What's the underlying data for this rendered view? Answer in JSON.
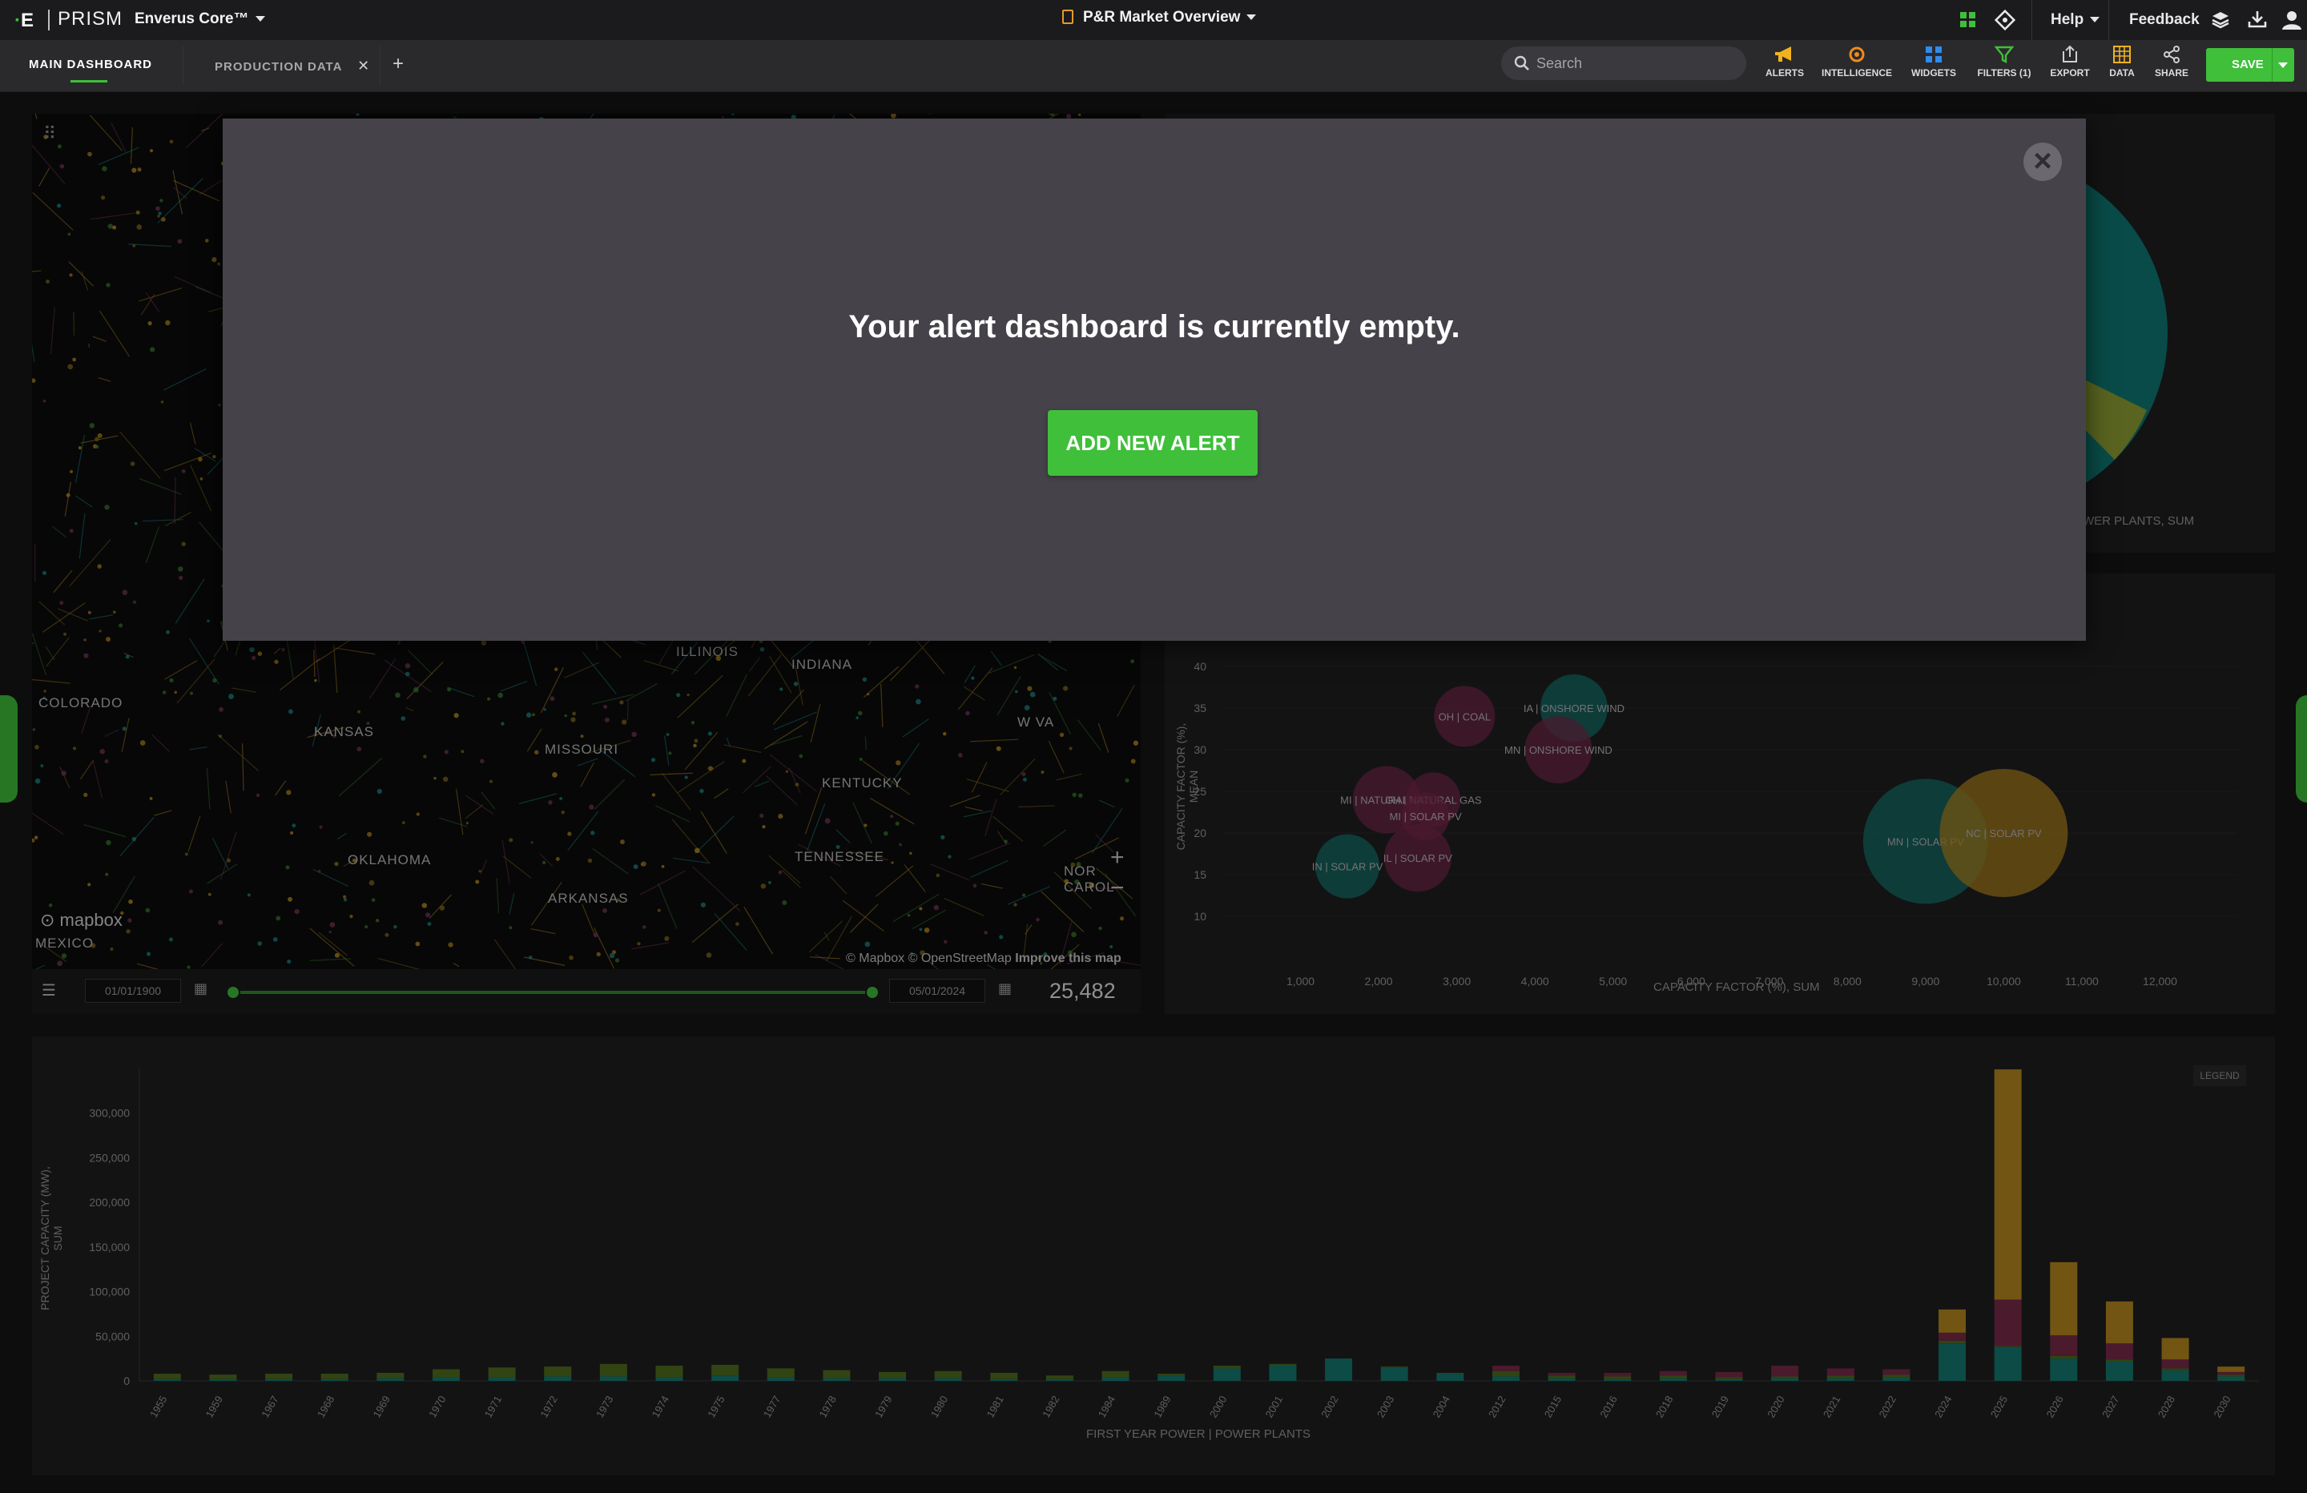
{
  "topbar": {
    "logo": "E",
    "brand": "PRISM",
    "product": "Enverus Core™",
    "dashboard_title": "P&R Market Overview",
    "help": "Help",
    "feedback": "Feedback"
  },
  "tabs": [
    {
      "label": "MAIN DASHBOARD",
      "active": true
    },
    {
      "label": "PRODUCTION DATA",
      "active": false
    }
  ],
  "search": {
    "placeholder": "Search"
  },
  "toolbar": [
    {
      "label": "ALERTS",
      "icon": "megaphone-icon",
      "color": "#f0b21f"
    },
    {
      "label": "INTELLIGENCE",
      "icon": "intelligence-icon",
      "color": "#f08a1f"
    },
    {
      "label": "WIDGETS",
      "icon": "widgets-icon",
      "color": "#2d8cf0"
    },
    {
      "label": "FILTERS (1)",
      "icon": "filter-icon",
      "color": "#3fbf3a"
    },
    {
      "label": "EXPORT",
      "icon": "export-icon",
      "color": "#cfcfcf"
    },
    {
      "label": "DATA",
      "icon": "table-icon",
      "color": "#f0b21f"
    },
    {
      "label": "SHARE",
      "icon": "share-icon",
      "color": "#cfcfcf"
    }
  ],
  "save_label": "SAVE",
  "map": {
    "labels": [
      "COLORADO",
      "KANSAS",
      "MISSOURI",
      "ILLINOIS",
      "INDIANA",
      "KENTUCKY",
      "OKLAHOMA",
      "ARKANSAS",
      "TENNESSEE",
      "W VA",
      "NOR CAROL",
      "MEXICO"
    ],
    "mapbox": "mapbox",
    "attribution": "© Mapbox © OpenStreetMap",
    "improve": "Improve this map",
    "date_start": "01/01/1900",
    "date_end": "05/01/2024",
    "count": "25,482"
  },
  "pie_axis_label": "WER PLANTS, SUM",
  "bubble_chart": {
    "ylabel": "CAPACITY FACTOR (%), MEAN",
    "xlabel": "CAPACITY FACTOR (%), SUM"
  },
  "bar_chart": {
    "ylabel": "PROJECT CAPACITY (MW), SUM",
    "xlabel": "FIRST YEAR POWER | POWER PLANTS",
    "legend": "LEGEND"
  },
  "modal": {
    "message": "Your alert dashboard is currently empty.",
    "button": "ADD NEW ALERT"
  },
  "colors": {
    "accent": "#3fbf3a",
    "teal": "#157a72",
    "gold": "#b8891d",
    "maroon": "#7a2a49"
  },
  "chart_data": [
    {
      "type": "scatter",
      "xlabel": "CAPACITY FACTOR (%), SUM",
      "ylabel": "CAPACITY FACTOR (%), MEAN",
      "xlim": [
        0,
        13000
      ],
      "ylim": [
        5,
        40
      ],
      "x_ticks": [
        "1,000",
        "2,000",
        "3,000",
        "4,000",
        "5,000",
        "6,000",
        "7,000",
        "8,000",
        "9,000",
        "10,000",
        "11,000",
        "12,000"
      ],
      "y_ticks": [
        "10",
        "15",
        "20",
        "25",
        "30",
        "35",
        "40"
      ],
      "points": [
        {
          "label": "OH | COAL",
          "x": 3100,
          "y": 34,
          "r": 38,
          "color": "maroon"
        },
        {
          "label": "IA | ONSHORE WIND",
          "x": 4500,
          "y": 35,
          "r": 42,
          "color": "teal"
        },
        {
          "label": "MN | ONSHORE WIND",
          "x": 4300,
          "y": 30,
          "r": 42,
          "color": "maroon"
        },
        {
          "label": "MI | NATURAL GAS",
          "x": 2100,
          "y": 24,
          "r": 42,
          "color": "maroon"
        },
        {
          "label": "OH | NATURAL GAS",
          "x": 2700,
          "y": 24,
          "r": 34,
          "color": "maroon"
        },
        {
          "label": "MI | SOLAR PV",
          "x": 2600,
          "y": 22,
          "r": 30,
          "color": "maroon"
        },
        {
          "label": "IL | SOLAR PV",
          "x": 2500,
          "y": 17,
          "r": 42,
          "color": "maroon"
        },
        {
          "label": "IN | SOLAR PV",
          "x": 1600,
          "y": 16,
          "r": 40,
          "color": "teal"
        },
        {
          "label": "MN | SOLAR PV",
          "x": 9000,
          "y": 19,
          "r": 78,
          "color": "teal"
        },
        {
          "label": "NC | SOLAR PV",
          "x": 10000,
          "y": 20,
          "r": 80,
          "color": "gold"
        }
      ]
    },
    {
      "type": "bar",
      "xlabel": "FIRST YEAR POWER | POWER PLANTS",
      "ylabel": "PROJECT CAPACITY (MW), SUM",
      "ylim": [
        0,
        350000
      ],
      "y_ticks": [
        "0",
        "50,000",
        "100,000",
        "150,000",
        "200,000",
        "250,000",
        "300,000"
      ],
      "categories": [
        "1955",
        "1959",
        "1967",
        "1968",
        "1969",
        "1970",
        "1971",
        "1972",
        "1973",
        "1974",
        "1975",
        "1977",
        "1978",
        "1979",
        "1980",
        "1981",
        "1982",
        "1984",
        "1989",
        "2000",
        "2001",
        "2002",
        "2003",
        "2004",
        "2012",
        "2015",
        "2016",
        "2018",
        "2019",
        "2020",
        "2021",
        "2022",
        "2024",
        "2025",
        "2026",
        "2027",
        "2028",
        "2030"
      ],
      "series": [
        {
          "color": "teal",
          "values": [
            2000,
            2000,
            2000,
            2000,
            3000,
            4000,
            4000,
            5000,
            5000,
            4000,
            6000,
            4000,
            3000,
            3000,
            3000,
            2000,
            2000,
            4000,
            6000,
            14000,
            18000,
            25000,
            15000,
            8000,
            5000,
            3000,
            2000,
            3000,
            2000,
            3000,
            3000,
            4000,
            42000,
            38000,
            25000,
            22000,
            12000,
            5000
          ]
        },
        {
          "color": "olive",
          "values": [
            6000,
            5000,
            6000,
            6000,
            6000,
            9000,
            11000,
            11000,
            14000,
            13000,
            12000,
            10000,
            9000,
            7000,
            8000,
            7000,
            4000,
            7000,
            2000,
            3000,
            1000,
            0,
            1000,
            1000,
            6000,
            3000,
            3000,
            3000,
            2000,
            2000,
            3000,
            3000,
            3000,
            1000,
            3000,
            2000,
            2000,
            2000
          ]
        },
        {
          "color": "maroon",
          "values": [
            0,
            0,
            0,
            0,
            0,
            0,
            0,
            0,
            0,
            0,
            0,
            0,
            0,
            0,
            0,
            0,
            0,
            0,
            0,
            0,
            0,
            0,
            0,
            0,
            6000,
            3000,
            4000,
            5000,
            6000,
            12000,
            8000,
            6000,
            9000,
            52000,
            23000,
            18000,
            10000,
            3000
          ]
        },
        {
          "color": "gold",
          "values": [
            0,
            0,
            0,
            0,
            0,
            0,
            0,
            0,
            0,
            0,
            0,
            0,
            0,
            0,
            0,
            0,
            0,
            0,
            0,
            0,
            0,
            0,
            0,
            0,
            0,
            0,
            0,
            0,
            0,
            0,
            0,
            0,
            26000,
            258000,
            82000,
            47000,
            24000,
            6000
          ]
        }
      ]
    }
  ]
}
